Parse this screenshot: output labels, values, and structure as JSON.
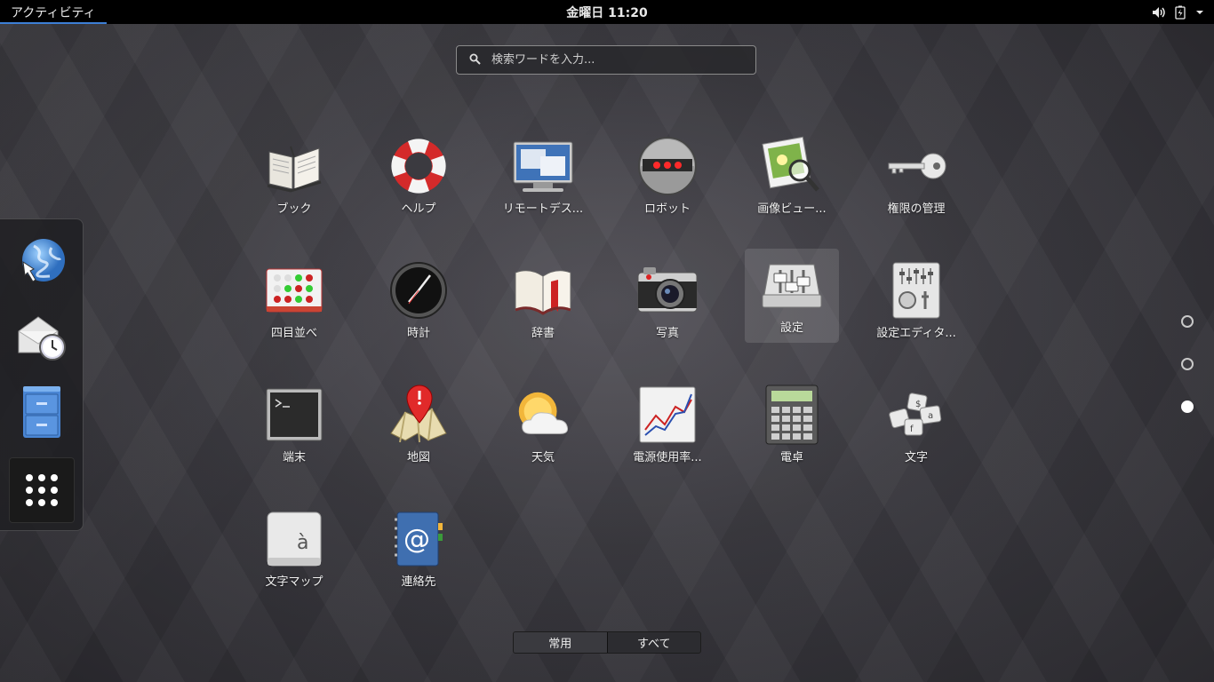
{
  "topbar": {
    "activities_label": "アクティビティ",
    "clock": "金曜日 11:20",
    "icons": [
      "volume-icon",
      "battery-icon",
      "menu-chevron-icon"
    ]
  },
  "search": {
    "placeholder": "検索ワードを入力..."
  },
  "dash": {
    "items": [
      {
        "name": "web-browser",
        "icon": "globe-icon"
      },
      {
        "name": "evolution-mail",
        "icon": "mail-clock-icon"
      },
      {
        "name": "files",
        "icon": "file-cabinet-icon"
      },
      {
        "name": "show-applications",
        "icon": "app-grid-icon"
      }
    ]
  },
  "apps": [
    {
      "label": "ブック",
      "icon": "book-icon"
    },
    {
      "label": "ヘルプ",
      "icon": "lifebuoy-icon"
    },
    {
      "label": "リモートデス...",
      "icon": "remote-desktop-icon"
    },
    {
      "label": "ロボット",
      "icon": "robot-icon"
    },
    {
      "label": "画像ビュー...",
      "icon": "image-viewer-icon"
    },
    {
      "label": "権限の管理",
      "icon": "key-icon"
    },
    {
      "label": "四目並べ",
      "icon": "four-in-a-row-icon"
    },
    {
      "label": "時計",
      "icon": "clock-icon"
    },
    {
      "label": "辞書",
      "icon": "dictionary-icon"
    },
    {
      "label": "写真",
      "icon": "camera-icon"
    },
    {
      "label": "設定",
      "icon": "settings-sliders-icon"
    },
    {
      "label": "設定エディタ...",
      "icon": "config-editor-icon"
    },
    {
      "label": "端末",
      "icon": "terminal-icon"
    },
    {
      "label": "地図",
      "icon": "maps-icon"
    },
    {
      "label": "天気",
      "icon": "weather-icon"
    },
    {
      "label": "電源使用率...",
      "icon": "power-statistics-icon"
    },
    {
      "label": "電卓",
      "icon": "calculator-icon"
    },
    {
      "label": "文字",
      "icon": "characters-icon"
    },
    {
      "label": "文字マップ",
      "icon": "character-map-icon"
    },
    {
      "label": "連絡先",
      "icon": "contacts-icon"
    }
  ],
  "pager": {
    "pages": 3,
    "current": 3
  },
  "view_switch": {
    "frequent": "常用",
    "all": "すべて",
    "active": "frequent"
  }
}
